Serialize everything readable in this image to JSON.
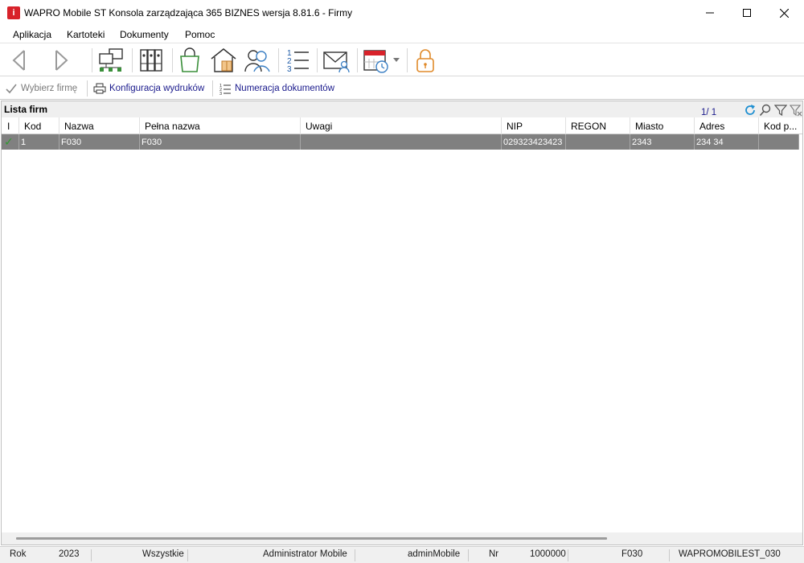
{
  "window": {
    "title": "WAPRO Mobile ST Konsola zarządzająca 365 BIZNES wersja 8.81.6 - Firmy",
    "app_icon_text": "i"
  },
  "menu": [
    "Aplikacja",
    "Kartoteki",
    "Dokumenty",
    "Pomoc"
  ],
  "toolbar": {
    "icons": [
      "back-arrow-icon",
      "forward-arrow-icon",
      "network-icon",
      "binders-icon",
      "shopping-bag-icon",
      "warehouse-icon",
      "users-icon",
      "numbered-list-icon",
      "mail-user-icon",
      "calendar-clock-icon",
      "lock-icon"
    ]
  },
  "actions": {
    "select_company": "Wybierz firmę",
    "print_config": "Konfiguracja wydruków",
    "doc_numbering": "Numeracja dokumentów"
  },
  "list": {
    "title": "Lista firm",
    "page_count": "1/ 1",
    "columns": [
      "I",
      "Kod",
      "Nazwa",
      "Pełna nazwa",
      "Uwagi",
      "NIP",
      "REGON",
      "Miasto",
      "Adres",
      "Kod p..."
    ],
    "rows": [
      {
        "active": "✓",
        "kod": "1",
        "nazwa": "F030",
        "pelna_nazwa": "F030",
        "uwagi": "",
        "nip": "029323423423",
        "regon": "",
        "miasto": "2343",
        "adres": "234 34",
        "kod_p": ""
      }
    ]
  },
  "status": {
    "rok_label": "Rok",
    "rok_value": "2023",
    "scope": "Wszystkie",
    "user": "Administrator Mobile",
    "login": "adminMobile",
    "nr_label": "Nr",
    "nr_value": "1000000",
    "company": "F030",
    "database": "WAPROMOBILEST_030"
  },
  "colors": {
    "selected_row": "#808080",
    "app_icon": "#d8222a",
    "link_text": "#1a1a8c",
    "refresh_icon": "#1f8fd1"
  }
}
